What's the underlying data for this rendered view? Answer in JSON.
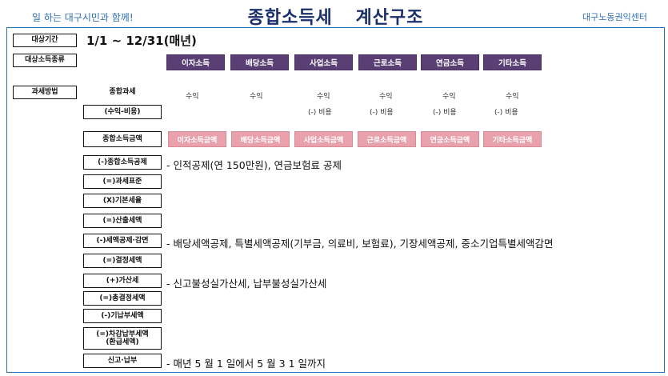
{
  "header": {
    "slogan": "일 하는 대구시민과 함께!",
    "title_part1": "종합소득세",
    "title_part2": "계산구조",
    "org": "대구노동권익센터"
  },
  "period": {
    "label": "대상기간",
    "value": "1/1 ~ 12/31(매년)"
  },
  "income_types": {
    "label": "대상소득종류",
    "items": [
      "이자소득",
      "배당소득",
      "사업소득",
      "근로소득",
      "연금소득",
      "기타소득"
    ]
  },
  "method": {
    "label": "과세방법",
    "comprehensive": "종합과세",
    "formula": "(수익-비용)",
    "revenue": [
      "수익",
      "수익",
      "수익",
      "수익",
      "수익",
      "수익"
    ],
    "cost": [
      "(-) 비용",
      "(-) 비용",
      "(-) 비용",
      "(-) 비용"
    ]
  },
  "amounts": {
    "label": "종합소득금액",
    "items": [
      "이자소득금액",
      "배당소득금액",
      "사업소득금액",
      "근로소득금액",
      "연금소득금액",
      "기타소득금액"
    ]
  },
  "steps": [
    {
      "label": "(-)종합소득공제",
      "note": "- 인적공제(연 150만원), 연금보험료 공제"
    },
    {
      "label": "(=)과세표준",
      "note": ""
    },
    {
      "label": "(X)기본세율",
      "note": ""
    },
    {
      "label": "(=)산출세액",
      "note": ""
    },
    {
      "label": "(-)세액공제·감면",
      "note": "- 배당세액공제, 특별세액공제(기부금, 의료비, 보험료), 기장세액공제, 중소기업특별세액감면"
    },
    {
      "label": "(=)결정세액",
      "note": ""
    },
    {
      "label": "(+)가산세",
      "note": "- 신고불성실가산세, 납부불성실가산세"
    },
    {
      "label": "(=)총결정세액",
      "note": ""
    },
    {
      "label": "(-)기납부세액",
      "note": ""
    },
    {
      "label_line1": "(=)차감납부세액",
      "label_line2": "(환급세액)",
      "note": ""
    },
    {
      "label": "신고·납부",
      "note": "- 매년 5 월 1 일에서 5 월 3 1 일까지"
    }
  ]
}
